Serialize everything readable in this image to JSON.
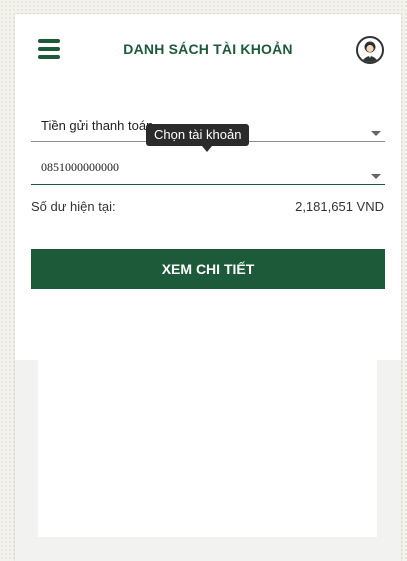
{
  "header": {
    "title": "DANH SÁCH TÀI KHOẢN",
    "menu_icon": "hamburger-menu-icon",
    "avatar_icon": "user-avatar-icon",
    "brand_color": "#1c5a3a"
  },
  "account": {
    "type_value": "Tiền gửi thanh toán",
    "number_value": "0851000000000",
    "tooltip": "Chọn tài khoản",
    "balance_label": "Số dư hiện tại:",
    "balance_value": "2,181,651 VND"
  },
  "actions": {
    "detail_label": "XEM CHI TIẾT"
  }
}
